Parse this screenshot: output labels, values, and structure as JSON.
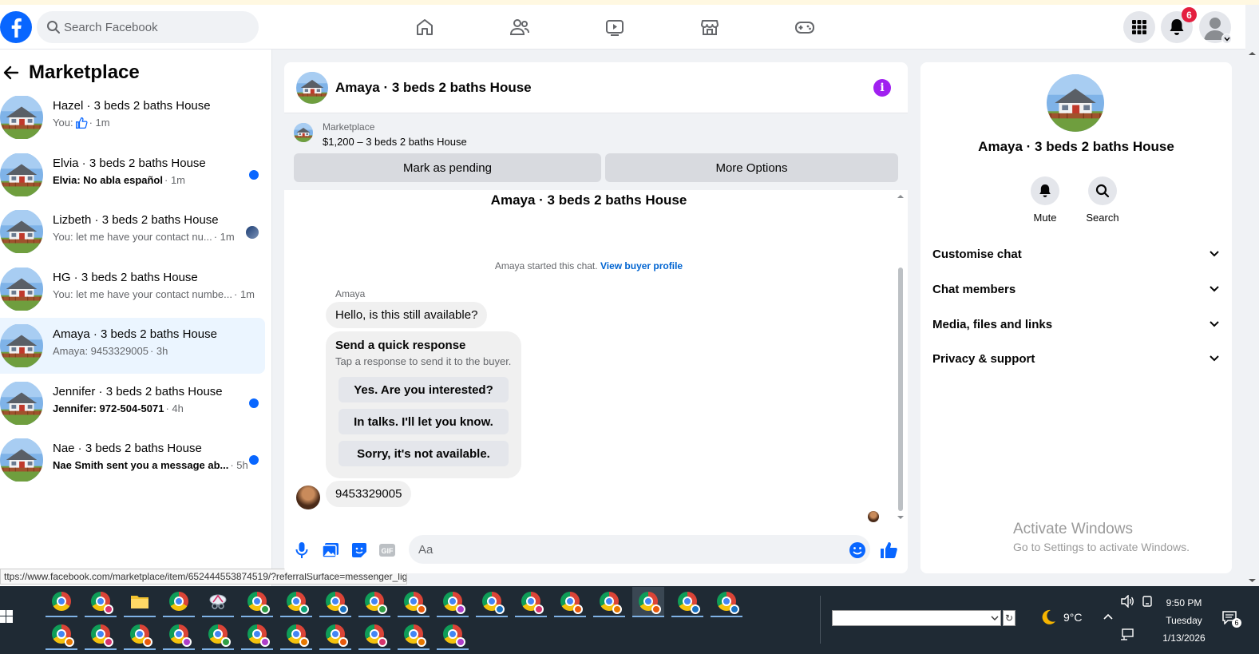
{
  "header": {
    "search_placeholder": "Search Facebook",
    "notification_count": "6"
  },
  "sidebar": {
    "title": "Marketplace",
    "conversations": [
      {
        "name": "Hazel · 3 beds 2 baths House",
        "prefix": "You:",
        "time": "· 1m",
        "unread": false,
        "indicator": "none"
      },
      {
        "name": "Elvia · 3 beds 2 baths House",
        "prefix": "Elvia: No abla español",
        "time": "· 1m",
        "unread": true,
        "indicator": "dot"
      },
      {
        "name": "Lizbeth · 3 beds 2 baths House",
        "prefix": "You: let me have your contact nu...",
        "time": "· 1m",
        "unread": false,
        "indicator": "avatar"
      },
      {
        "name": "HG · 3 beds 2 baths House",
        "prefix": "You: let me have your contact numbe...",
        "time": "· 1m",
        "unread": false,
        "indicator": "none"
      },
      {
        "name": "Amaya · 3 beds 2 baths House",
        "prefix": "Amaya: 9453329005",
        "time": "· 3h",
        "unread": false,
        "indicator": "none",
        "active": true
      },
      {
        "name": "Jennifer · 3 beds 2 baths House",
        "prefix": "Jennifer: 972-504-5071",
        "time": "· 4h",
        "unread": true,
        "indicator": "dot"
      },
      {
        "name": "Nae · 3 beds 2 baths House",
        "prefix": "Nae Smith sent you a message ab...",
        "time": "· 5h",
        "unread": true,
        "indicator": "dot"
      }
    ]
  },
  "status_url": "ttps://www.facebook.com/marketplace/item/652444553874519/?referralSurface=messenger_lig...",
  "chat": {
    "title": "Amaya · 3 beds 2 baths House",
    "listing_category": "Marketplace",
    "listing_price": "$1,200 – 3 beds 2 baths House",
    "mark_pending": "Mark as pending",
    "more_options": "More Options",
    "thread_title": "Amaya · 3 beds 2 baths House",
    "started_text": "Amaya started this chat.",
    "view_profile": "View buyer profile",
    "sender_name": "Amaya",
    "message_1": "Hello, is this still available?",
    "quick_title": "Send a quick response",
    "quick_subtitle": "Tap a response to send it to the buyer.",
    "quick_options": [
      "Yes. Are you interested?",
      "In talks. I'll let you know.",
      "Sorry, it's not available."
    ],
    "message_2": "9453329005",
    "composer_placeholder": "Aa",
    "gif_label": "GIF"
  },
  "panel": {
    "title": "Amaya · 3 beds 2 baths House",
    "mute_label": "Mute",
    "search_label": "Search",
    "sections": [
      "Customise chat",
      "Chat members",
      "Media, files and links",
      "Privacy & support"
    ]
  },
  "activate": {
    "line1": "Activate Windows",
    "line2": "Go to Settings to activate Windows."
  },
  "taskbar": {
    "temperature": "9°C",
    "time": "9:50 PM",
    "day": "Tuesday",
    "date": "1/13/2026",
    "notification_count": "6",
    "profile_colors_row1": [
      "",
      "#d6336c",
      "",
      "",
      "",
      "#2f9e44",
      "#0ca678",
      "#1971c2",
      "#2f9e44",
      "#e8590c",
      "#ae3ec9",
      "#1971c2",
      "#d6336c",
      "#e8590c",
      "#e67700",
      "#e8590c",
      "#1971c2",
      "#1971c2"
    ],
    "profile_colors_row2": [
      "#e67700",
      "#d6336c",
      "#e8590c",
      "#ae3ec9",
      "#2f9e44",
      "#ae3ec9",
      "#e67700",
      "#e8590c",
      "#d6336c",
      "#e67700",
      "#ae3ec9"
    ]
  },
  "colors": {
    "brand": "#0866ff",
    "unread_dot": "#0866ff",
    "info": "#a020f0",
    "active_row": "#ebf5ff"
  }
}
